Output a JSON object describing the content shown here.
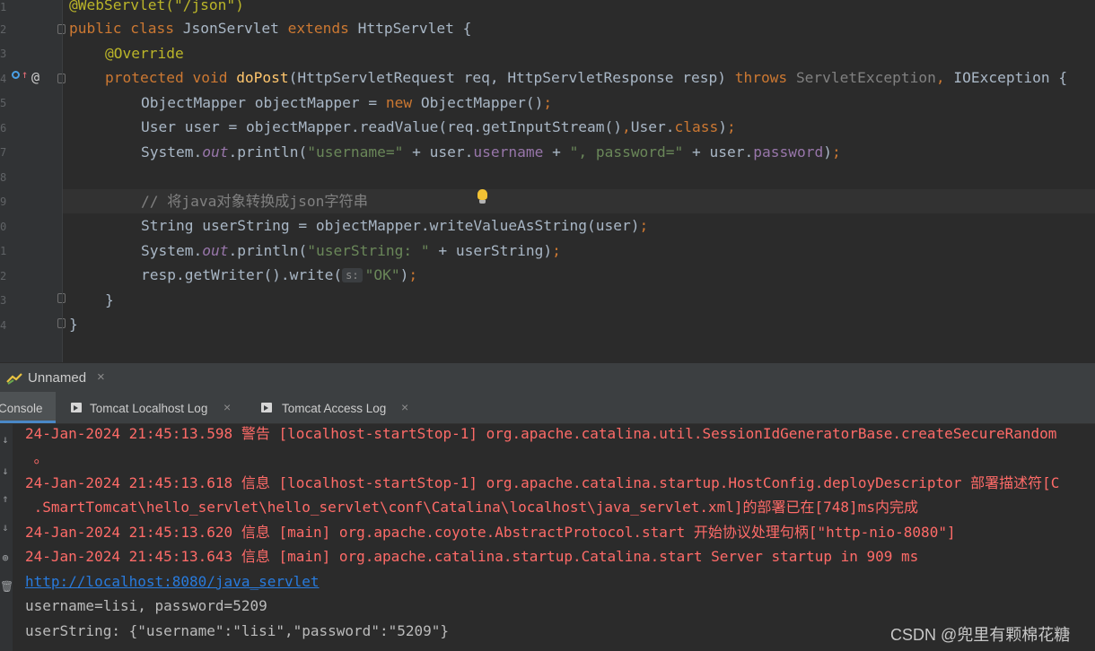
{
  "editor": {
    "line_numbers": [
      "1",
      "2",
      "3",
      "4",
      "5",
      "6",
      "7",
      "8",
      "9",
      "0",
      "1",
      "2",
      "3",
      "4"
    ],
    "code": {
      "l1_annotation": "@WebServlet(\"/json\")",
      "l2_public": "public ",
      "l2_class": "class ",
      "l2_name": "JsonServlet ",
      "l2_extends": "extends ",
      "l2_rest": "HttpServlet {",
      "l3_override": "@Override",
      "l4_protected": "protected void ",
      "l4_method": "doPost",
      "l4_params": "(HttpServletRequest req, HttpServletResponse resp) ",
      "l4_throws": "throws ",
      "l4_ex1": "ServletException",
      "l4_comma": ", ",
      "l4_ex2": "IOException {",
      "l5_a": "ObjectMapper objectMapper = ",
      "l5_new": "new ",
      "l5_b": "ObjectMapper()",
      "l5_semi": ";",
      "l6_a": "User user = objectMapper.readValue(req.getInputStream()",
      "l6_comma": ",",
      "l6_b": "User.",
      "l6_class": "class",
      "l6_c": ")",
      "l6_semi": ";",
      "l7_a": "System.",
      "l7_out": "out",
      "l7_b": ".println(",
      "l7_s1": "\"username=\"",
      "l7_c": " + user.",
      "l7_f1": "username",
      "l7_d": " + ",
      "l7_s2": "\", password=\"",
      "l7_e": " + user.",
      "l7_f2": "password",
      "l7_f": ")",
      "l7_semi": ";",
      "l9_comment": "// 将java对象转换成json字符串",
      "l10_a": "String userString = objectMapper.writeValueAsString(user)",
      "l10_semi": ";",
      "l11_a": "System.",
      "l11_out": "out",
      "l11_b": ".println(",
      "l11_s": "\"userString: \"",
      "l11_c": " + userString)",
      "l11_semi": ";",
      "l12_a": "resp.getWriter().write(",
      "l12_hint": "s:",
      "l12_s": "\"OK\"",
      "l12_b": ")",
      "l12_semi": ";",
      "l13": "}",
      "l14": "}"
    },
    "gutter_at": "@",
    "gutter_arrow": "↑"
  },
  "run_panel": {
    "title": "Unnamed",
    "close": "×",
    "tabs": [
      {
        "label": "Console",
        "close": ""
      },
      {
        "label": "Tomcat Localhost Log",
        "close": "×"
      },
      {
        "label": "Tomcat Access Log",
        "close": "×"
      }
    ],
    "gutter_icons": [
      "↓",
      "↓",
      "⇑",
      "⇓",
      "⊕",
      "🗑"
    ]
  },
  "console": {
    "lines": [
      "24-Jan-2024 21:45:13.598 警告 [localhost-startStop-1] org.apache.catalina.util.SessionIdGeneratorBase.createSecureRandom",
      " 。",
      "24-Jan-2024 21:45:13.618 信息 [localhost-startStop-1] org.apache.catalina.startup.HostConfig.deployDescriptor 部署描述符[C",
      " .SmartTomcat\\hello_servlet\\hello_servlet\\conf\\Catalina\\localhost\\java_servlet.xml]的部署已在[748]ms内完成",
      "24-Jan-2024 21:45:13.620 信息 [main] org.apache.coyote.AbstractProtocol.start 开始协议处理句柄[\"http-nio-8080\"]",
      "24-Jan-2024 21:45:13.643 信息 [main] org.apache.catalina.startup.Catalina.start Server startup in 909 ms",
      "http://localhost:8080/java_servlet",
      "username=lisi, password=5209",
      "userString: {\"username\":\"lisi\",\"password\":\"5209\"}"
    ]
  },
  "watermark": "CSDN @兜里有颗棉花糖",
  "colors": {
    "background": "#2b2b2b",
    "keyword": "#cc7832",
    "string": "#6a8759",
    "field": "#9876aa",
    "log_error": "#ff6b68",
    "link": "#287bde"
  }
}
